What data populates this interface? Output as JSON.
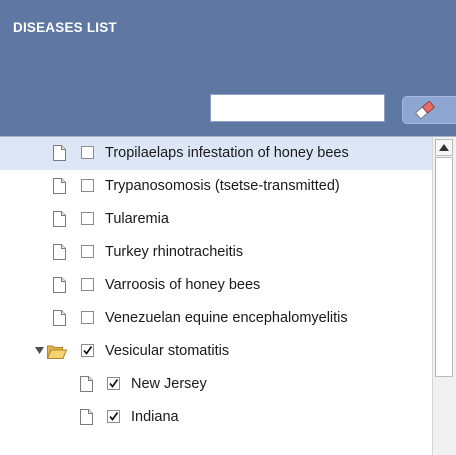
{
  "panel": {
    "title": "DISEASES LIST",
    "background_color": "#5e77a3"
  },
  "search": {
    "value": "",
    "clear_icon": "eraser-icon"
  },
  "list": {
    "items": [
      {
        "label": "Tropilaelaps infestation of honey bees",
        "checked": false,
        "selected": true,
        "type": "file"
      },
      {
        "label": "Trypanosomosis (tsetse-transmitted)",
        "checked": false,
        "selected": false,
        "type": "file"
      },
      {
        "label": "Tularemia",
        "checked": false,
        "selected": false,
        "type": "file"
      },
      {
        "label": "Turkey rhinotracheitis",
        "checked": false,
        "selected": false,
        "type": "file"
      },
      {
        "label": "Varroosis of honey bees",
        "checked": false,
        "selected": false,
        "type": "file"
      },
      {
        "label": "Venezuelan equine encephalomyelitis",
        "checked": false,
        "selected": false,
        "type": "file"
      },
      {
        "label": "Vesicular stomatitis",
        "checked": true,
        "selected": false,
        "type": "folder-open"
      },
      {
        "label": "New Jersey",
        "checked": true,
        "selected": false,
        "type": "file",
        "child": true
      },
      {
        "label": "Indiana",
        "checked": true,
        "selected": false,
        "type": "file",
        "child": true
      }
    ]
  },
  "scrollbar": {
    "up_icon": "scroll-up-arrow-icon"
  }
}
